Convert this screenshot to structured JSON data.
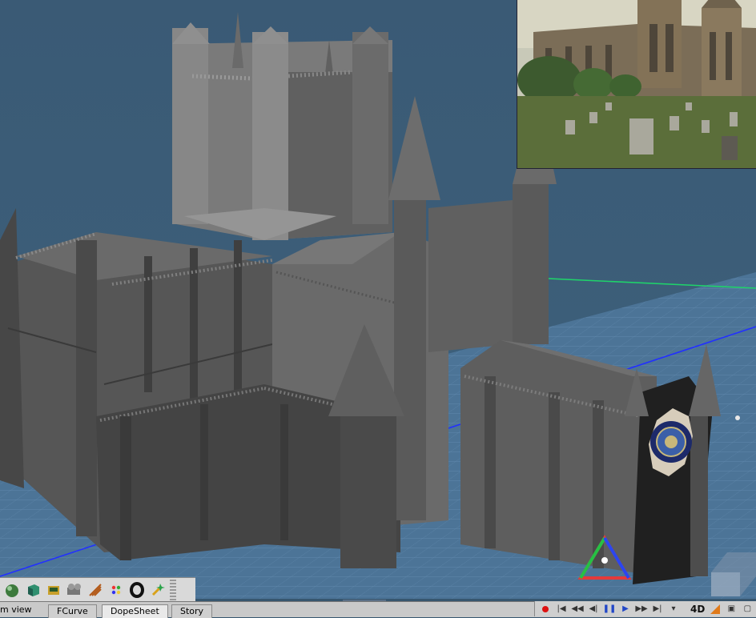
{
  "viewport": {
    "name": "3D perspective viewport",
    "background_color": "#3b5b76",
    "model": "cathedral-mesh",
    "reference_image": "cathedral-photo-reference"
  },
  "toolbar": {
    "tools": [
      {
        "icon": "sphere-tool-icon"
      },
      {
        "icon": "cube-tool-icon"
      },
      {
        "icon": "material-tool-icon"
      },
      {
        "icon": "camera-tool-icon"
      },
      {
        "icon": "particle-tool-icon"
      },
      {
        "icon": "palette-tool-icon"
      },
      {
        "icon": "ring-tool-icon"
      },
      {
        "icon": "light-tool-icon"
      }
    ]
  },
  "statusbar": {
    "view_label": "m view",
    "tabs": [
      "FCurve",
      "DopeSheet",
      "Story"
    ],
    "active_tab": "DopeSheet",
    "mode_label": "4D"
  },
  "colors": {
    "grid_line": "#5f86ad",
    "axis_blue": "#2230ff",
    "axis_green": "#1fd36a",
    "panel": "#d9d9d9"
  }
}
